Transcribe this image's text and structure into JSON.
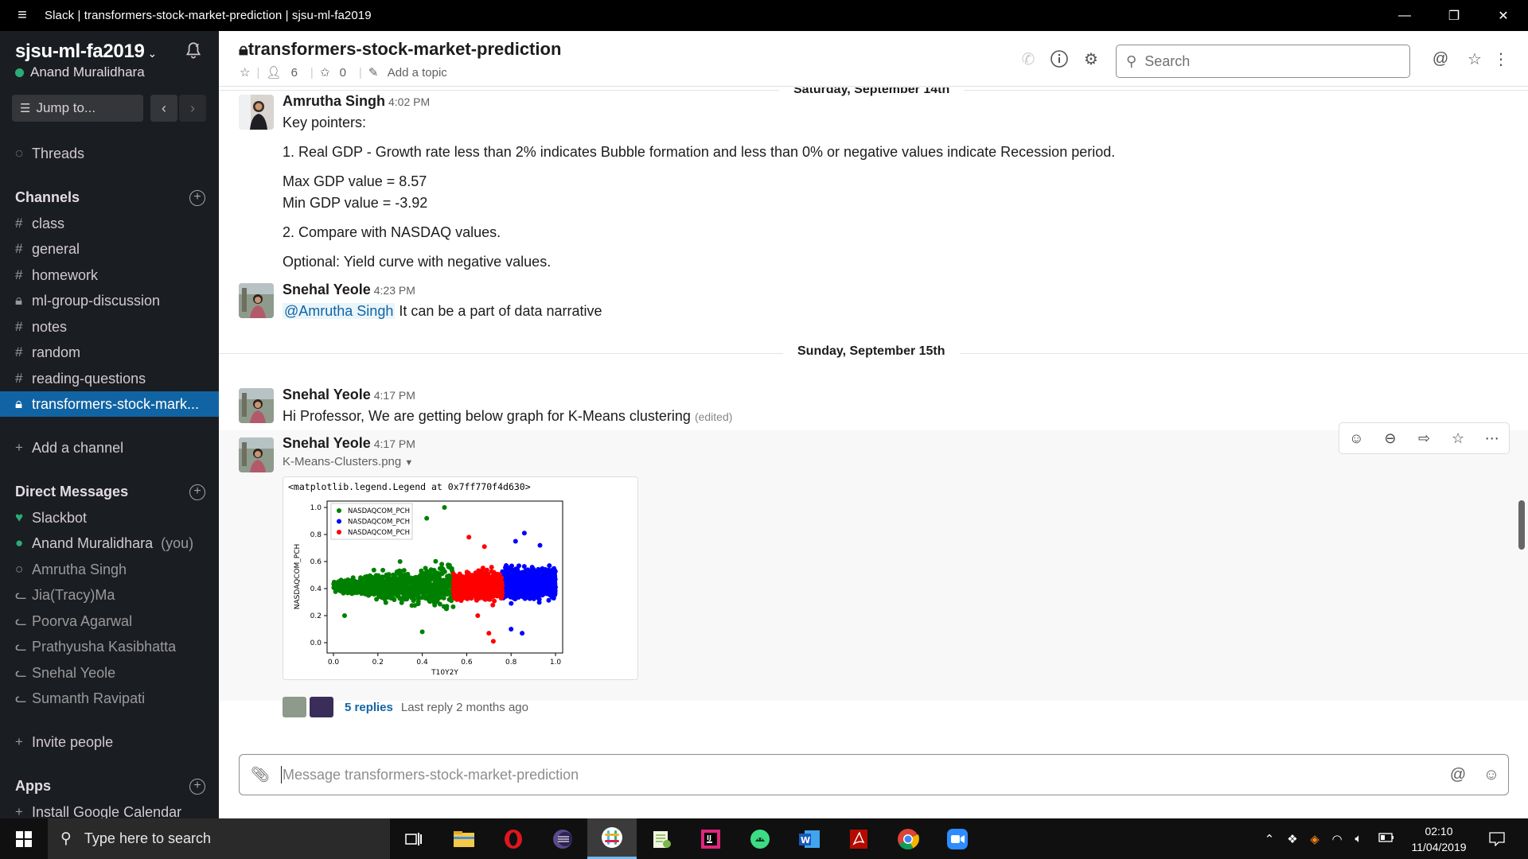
{
  "window": {
    "title": "Slack | transformers-stock-market-prediction | sjsu-ml-fa2019"
  },
  "sidebar": {
    "workspace": "sjsu-ml-fa2019",
    "user": "Anand Muralidhara",
    "jump": "Jump to...",
    "threads": "Threads",
    "channels_heading": "Channels",
    "channels": [
      {
        "prefix": "#",
        "name": "class"
      },
      {
        "prefix": "#",
        "name": "general"
      },
      {
        "prefix": "#",
        "name": "homework"
      },
      {
        "prefix": "lock",
        "name": "ml-group-discussion"
      },
      {
        "prefix": "#",
        "name": "notes"
      },
      {
        "prefix": "#",
        "name": "random"
      },
      {
        "prefix": "#",
        "name": "reading-questions"
      },
      {
        "prefix": "lock",
        "name": "transformers-stock-mark..."
      }
    ],
    "add_channel": "Add a channel",
    "dm_heading": "Direct Messages",
    "dms": [
      {
        "name": "Slackbot",
        "you": ""
      },
      {
        "name": "Anand Muralidhara",
        "you": "(you)"
      },
      {
        "name": "Amrutha Singh",
        "you": ""
      },
      {
        "name": "Jia(Tracy)Ma",
        "you": ""
      },
      {
        "name": "Poorva Agarwal",
        "you": ""
      },
      {
        "name": "Prathyusha Kasibhatta",
        "you": ""
      },
      {
        "name": "Snehal Yeole",
        "you": ""
      },
      {
        "name": "Sumanth Ravipati",
        "you": ""
      }
    ],
    "invite": "Invite people",
    "apps_heading": "Apps",
    "install_gcal": "Install Google Calendar"
  },
  "header": {
    "channel": "transformers-stock-market-prediction",
    "members": "6",
    "pins": "0",
    "topic": "Add a topic",
    "search_placeholder": "Search"
  },
  "messages": {
    "day1": "Saturday, September 14th",
    "day2": "Sunday, September 15th",
    "m1": {
      "author": "Amrutha Singh",
      "time": "4:02 PM",
      "lines": [
        "Key pointers:",
        "1. Real GDP - Growth rate less than 2% indicates Bubble formation and less than 0% or negative values indicate Recession period.",
        "Max GDP value = 8.57",
        "Min GDP value = -3.92",
        "2. Compare with NASDAQ values.",
        "Optional: Yield curve with negative values."
      ]
    },
    "m2": {
      "author": "Snehal Yeole",
      "time": "4:23 PM",
      "mention": "@Amrutha Singh",
      "text": " It can be a part of data narrative"
    },
    "m3": {
      "author": "Snehal Yeole",
      "time": "4:17 PM",
      "text": "Hi Professor, We are getting below graph for K-Means clustering",
      "edited": "(edited)"
    },
    "m4": {
      "author": "Snehal Yeole",
      "time": "4:17 PM",
      "file": "K-Means-Clusters.png",
      "replies": "5 replies",
      "last_reply": "Last reply 2 months ago"
    }
  },
  "chart_data": {
    "type": "scatter",
    "caption": "<matplotlib.legend.Legend at 0x7ff770f4d630>",
    "xlabel": "T10Y2Y",
    "ylabel": "NASDAQCOM_PCH",
    "xlim": [
      0.0,
      1.0
    ],
    "ylim": [
      0.0,
      1.0
    ],
    "xticks": [
      "0.0",
      "0.2",
      "0.4",
      "0.6",
      "0.8",
      "1.0"
    ],
    "yticks": [
      "0.0",
      "0.2",
      "0.4",
      "0.6",
      "0.8",
      "1.0"
    ],
    "legend_position": "top-left",
    "series": [
      {
        "name": "NASDAQCOM_PCH",
        "color": "#008000",
        "x_range": [
          0.0,
          0.54
        ],
        "center_y": 0.42,
        "spread_y": 0.09,
        "outliers": [
          [
            0.5,
            1.0
          ],
          [
            0.42,
            0.92
          ],
          [
            0.05,
            0.2
          ],
          [
            0.4,
            0.08
          ],
          [
            0.3,
            0.6
          ]
        ]
      },
      {
        "name": "NASDAQCOM_PCH",
        "color": "#0000ff",
        "x_range": [
          0.76,
          1.0
        ],
        "center_y": 0.44,
        "spread_y": 0.09,
        "outliers": [
          [
            0.86,
            0.81
          ],
          [
            0.82,
            0.75
          ],
          [
            0.8,
            0.1
          ],
          [
            0.85,
            0.07
          ],
          [
            0.93,
            0.72
          ]
        ]
      },
      {
        "name": "NASDAQCOM_PCH",
        "color": "#ff0000",
        "x_range": [
          0.54,
          0.76
        ],
        "center_y": 0.42,
        "spread_y": 0.08,
        "outliers": [
          [
            0.61,
            0.78
          ],
          [
            0.68,
            0.71
          ],
          [
            0.72,
            0.01
          ],
          [
            0.7,
            0.07
          ],
          [
            0.65,
            0.2
          ]
        ]
      }
    ]
  },
  "composer": {
    "placeholder": "Message transformers-stock-market-prediction"
  },
  "taskbar": {
    "search": "Type here to search",
    "time": "02:10",
    "date": "11/04/2019"
  }
}
